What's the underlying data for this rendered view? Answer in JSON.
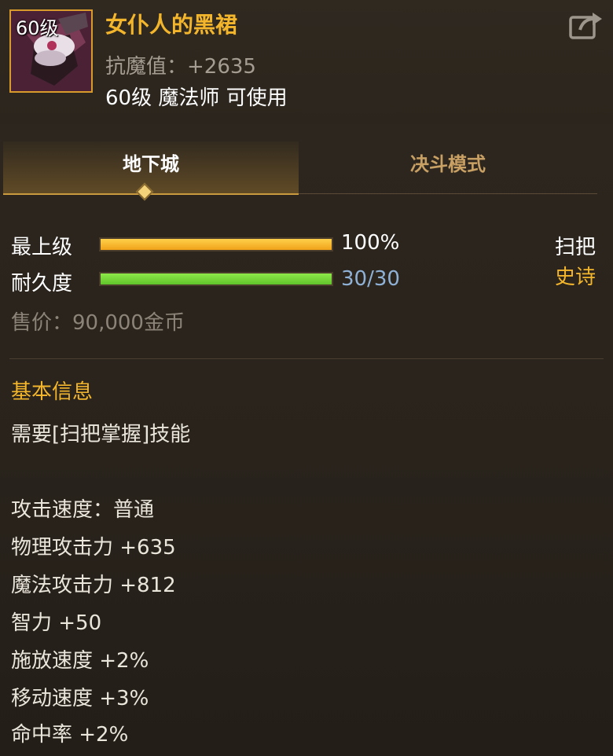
{
  "item": {
    "level_badge": "60级",
    "name": "女仆人的黑裙",
    "stat_line": "抗魔值：+2635",
    "requirement": "60级 魔法师 可使用",
    "icon": "black-dress-icon",
    "share_icon": "share-icon"
  },
  "tabs": [
    {
      "label": "地下城",
      "active": true
    },
    {
      "label": "决斗模式",
      "active": false
    }
  ],
  "grade": {
    "label": "最上级",
    "value": "100%",
    "fill": 1.0,
    "color": "#f0a21a",
    "type_label": "扫把"
  },
  "durability": {
    "label": "耐久度",
    "value": "30/30",
    "fill": 1.0,
    "color": "#5fc42a",
    "rarity_label": "史诗"
  },
  "price": "售价：90,000金币",
  "basic_info": {
    "title": "基本信息",
    "skill_req": "需要[扫把掌握]技能",
    "attributes": [
      "攻击速度：普通",
      "物理攻击力 +635",
      "魔法攻击力 +812",
      "智力 +50",
      "施放速度 +2%",
      "移动速度 +3%",
      "命中率 +2%"
    ]
  },
  "colors": {
    "gold": "#f2b52c",
    "rarity_epic": "#f2b52c",
    "muted": "#8c8478"
  }
}
